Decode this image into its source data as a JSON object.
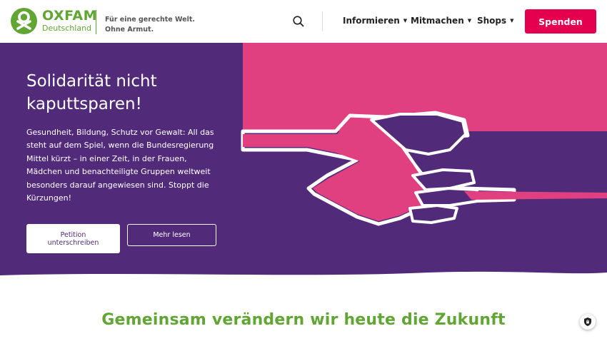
{
  "brand": {
    "name": "OXFAM",
    "sub": "Deutschland",
    "tagline_line1": "Für eine gerechte Welt.",
    "tagline_line2": "Ohne Armut.",
    "color": "#61a534"
  },
  "nav": {
    "search_icon": "search-icon",
    "items": [
      {
        "label": "Informieren"
      },
      {
        "label": "Mitmachen"
      },
      {
        "label": "Shops"
      }
    ],
    "donate_label": "Spenden",
    "donate_color": "#e5004f"
  },
  "hero": {
    "title": "Solidarität nicht kaputtsparen!",
    "body": "Gesundheit, Bildung, Schutz vor Gewalt: All das steht auf dem Spiel, wenn die Bundesregierung Mittel kürzt – in einer Zeit, in der Frauen, Mädchen und benachteiligte Gruppen weltweit besonders darauf angewiesen sind. Stoppt die Kürzungen!",
    "primary_button": "Petition unterschreiben",
    "secondary_button": "Mehr lesen",
    "colors": {
      "purple": "#522a7a",
      "pink": "#e0407f"
    }
  },
  "section": {
    "title": "Gemeinsam verändern wir heute die Zukunft"
  },
  "privacy": {
    "icon": "privacy-shield-icon"
  }
}
